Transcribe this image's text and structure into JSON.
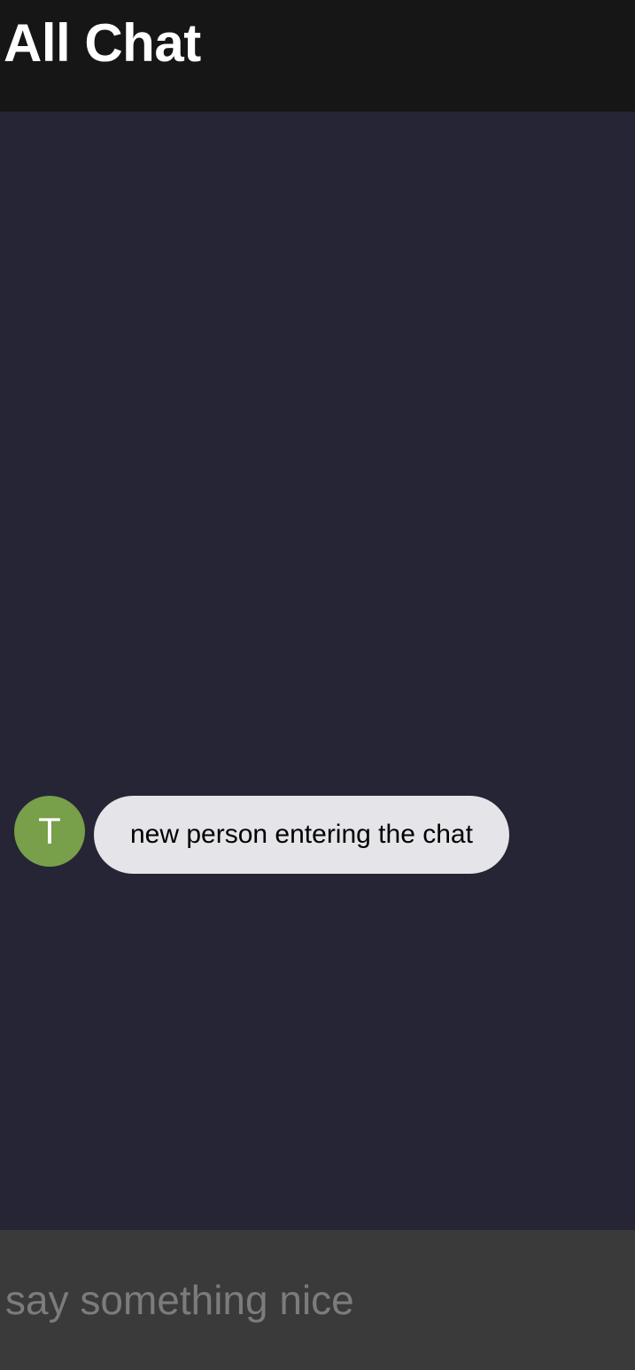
{
  "header": {
    "title": "All Chat"
  },
  "messages": [
    {
      "avatar_initial": "T",
      "avatar_color": "#789f49",
      "text": "new person entering the chat"
    }
  ],
  "composer": {
    "placeholder": "say something nice",
    "value": ""
  },
  "colors": {
    "header_background": "#161616",
    "chat_background": "#262535",
    "composer_background": "#3a3a3a",
    "bubble_background": "#e5e4e9"
  }
}
